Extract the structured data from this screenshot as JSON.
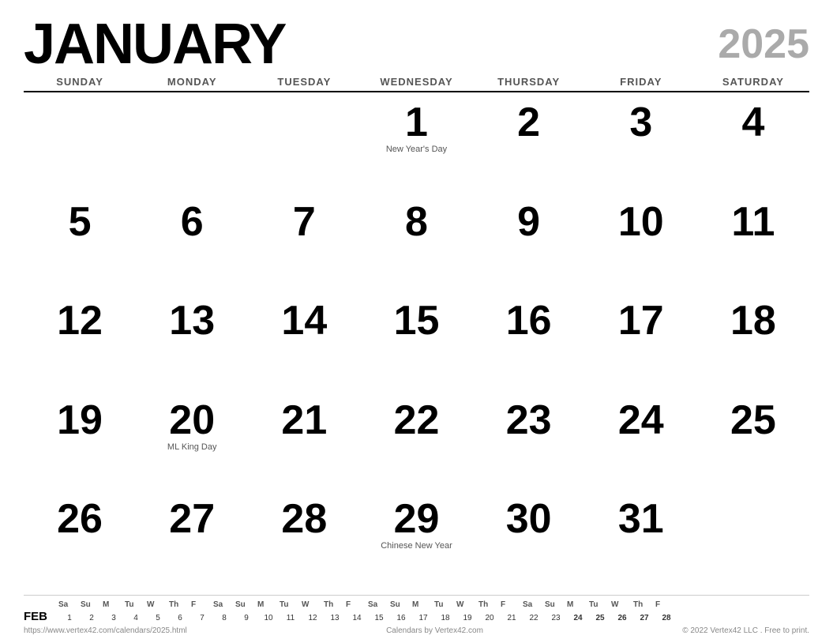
{
  "header": {
    "month": "JANUARY",
    "year": "2025"
  },
  "day_headers": [
    "SUNDAY",
    "MONDAY",
    "TUESDAY",
    "WEDNESDAY",
    "THURSDAY",
    "FRIDAY",
    "SATURDAY"
  ],
  "weeks": [
    [
      {
        "num": "",
        "holiday": ""
      },
      {
        "num": "",
        "holiday": ""
      },
      {
        "num": "",
        "holiday": ""
      },
      {
        "num": "1",
        "holiday": "New Year's Day"
      },
      {
        "num": "2",
        "holiday": ""
      },
      {
        "num": "3",
        "holiday": ""
      },
      {
        "num": "4",
        "holiday": ""
      }
    ],
    [
      {
        "num": "5",
        "holiday": ""
      },
      {
        "num": "6",
        "holiday": ""
      },
      {
        "num": "7",
        "holiday": ""
      },
      {
        "num": "8",
        "holiday": ""
      },
      {
        "num": "9",
        "holiday": ""
      },
      {
        "num": "10",
        "holiday": ""
      },
      {
        "num": "11",
        "holiday": ""
      }
    ],
    [
      {
        "num": "12",
        "holiday": ""
      },
      {
        "num": "13",
        "holiday": ""
      },
      {
        "num": "14",
        "holiday": ""
      },
      {
        "num": "15",
        "holiday": ""
      },
      {
        "num": "16",
        "holiday": ""
      },
      {
        "num": "17",
        "holiday": ""
      },
      {
        "num": "18",
        "holiday": ""
      }
    ],
    [
      {
        "num": "19",
        "holiday": ""
      },
      {
        "num": "20",
        "holiday": "ML King Day"
      },
      {
        "num": "21",
        "holiday": ""
      },
      {
        "num": "22",
        "holiday": ""
      },
      {
        "num": "23",
        "holiday": ""
      },
      {
        "num": "24",
        "holiday": ""
      },
      {
        "num": "25",
        "holiday": ""
      }
    ],
    [
      {
        "num": "26",
        "holiday": ""
      },
      {
        "num": "27",
        "holiday": ""
      },
      {
        "num": "28",
        "holiday": ""
      },
      {
        "num": "29",
        "holiday": "Chinese New Year"
      },
      {
        "num": "30",
        "holiday": ""
      },
      {
        "num": "31",
        "holiday": ""
      },
      {
        "num": "",
        "holiday": ""
      }
    ]
  ],
  "mini_cal": {
    "label": "FEB",
    "headers": [
      "Sa",
      "Su",
      "M",
      "Tu",
      "W",
      "Th",
      "F",
      "Sa",
      "Su",
      "M",
      "Tu",
      "W",
      "Th",
      "F",
      "Sa",
      "Su",
      "M",
      "Tu",
      "W",
      "Th",
      "F",
      "Sa",
      "Su",
      "M",
      "Tu",
      "W",
      "Th",
      "F"
    ],
    "days": [
      "1",
      "2",
      "3",
      "4",
      "5",
      "6",
      "7",
      "8",
      "9",
      "10",
      "11",
      "12",
      "13",
      "14",
      "15",
      "16",
      "17",
      "18",
      "19",
      "20",
      "21",
      "22",
      "23",
      "24",
      "25",
      "26",
      "27",
      "28"
    ]
  },
  "footer": {
    "url": "https://www.vertex42.com/calendars/2025.html",
    "brand": "Calendars by Vertex42.com",
    "copyright": "© 2022 Vertex42 LLC . Free to print."
  }
}
